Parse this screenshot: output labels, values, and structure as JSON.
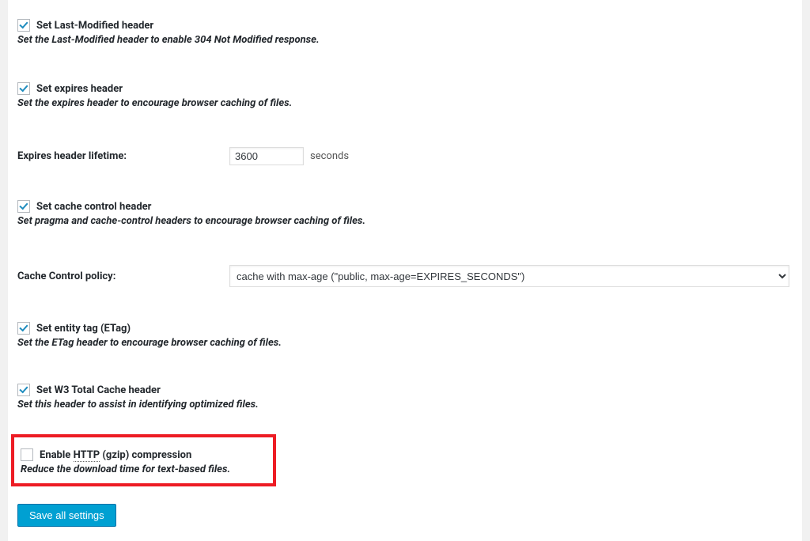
{
  "options": {
    "lastModified": {
      "label": "Set Last-Modified header",
      "desc": "Set the Last-Modified header to enable 304 Not Modified response.",
      "checked": true
    },
    "expires": {
      "label": "Set expires header",
      "desc": "Set the expires header to encourage browser caching of files.",
      "checked": true
    },
    "cacheControl": {
      "label": "Set cache control header",
      "desc": "Set pragma and cache-control headers to encourage browser caching of files.",
      "checked": true
    },
    "etag": {
      "label": "Set entity tag (ETag)",
      "desc": "Set the ETag header to encourage browser caching of files.",
      "checked": true
    },
    "w3tc": {
      "label": "Set W3 Total Cache header",
      "desc": "Set this header to assist in identifying optimized files.",
      "checked": true
    },
    "gzip": {
      "label_pre": "Enable ",
      "abbr": "HTTP",
      "label_post": " (gzip) compression",
      "desc": "Reduce the download time for text-based files.",
      "checked": false
    }
  },
  "expiresLifetime": {
    "label": "Expires header lifetime:",
    "value": "3600",
    "unit": "seconds"
  },
  "cachePolicy": {
    "label": "Cache Control policy:",
    "selected": "cache with max-age (\"public, max-age=EXPIRES_SECONDS\")"
  },
  "saveButton": "Save all settings"
}
